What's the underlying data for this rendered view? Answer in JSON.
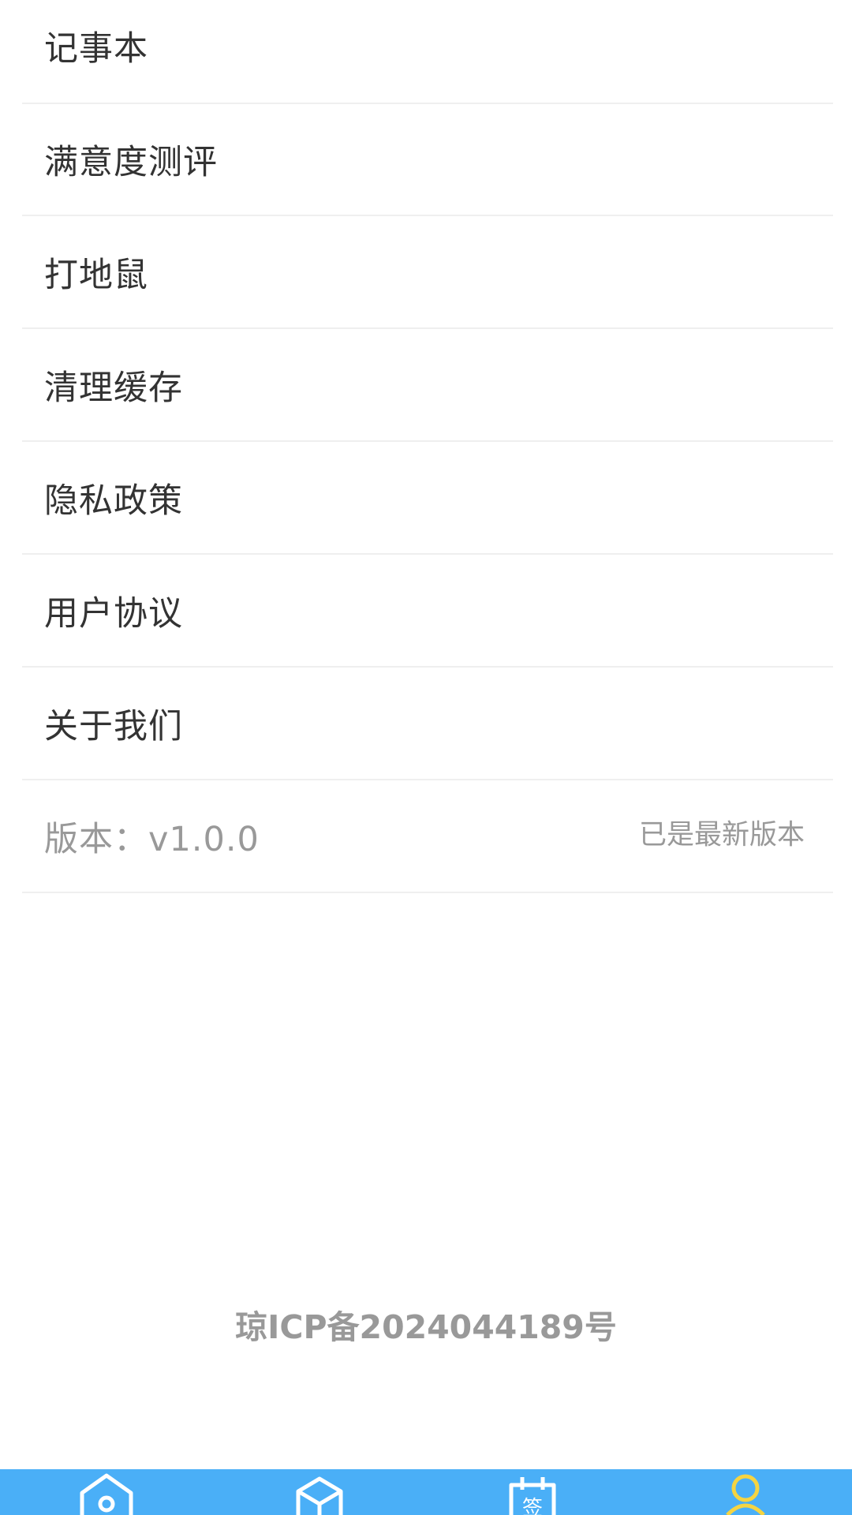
{
  "menu": {
    "items": [
      {
        "label": "记事本"
      },
      {
        "label": "满意度测评"
      },
      {
        "label": "打地鼠"
      },
      {
        "label": "清理缓存"
      },
      {
        "label": "隐私政策"
      },
      {
        "label": "用户协议"
      },
      {
        "label": "关于我们"
      }
    ],
    "version": {
      "label": "版本：v1.0.0",
      "status": "已是最新版本"
    }
  },
  "footer": {
    "icp": "琼ICP备2024044189号"
  },
  "tabbar": {
    "background": "#4aaff7",
    "tabs": [
      {
        "icon": "home-icon",
        "color": "#ffffff"
      },
      {
        "icon": "cube-icon",
        "color": "#ffffff"
      },
      {
        "icon": "sign-calendar-icon",
        "color": "#ffffff",
        "glyph": "签"
      },
      {
        "icon": "user-icon",
        "color": "#f5d442",
        "active": true
      }
    ]
  }
}
